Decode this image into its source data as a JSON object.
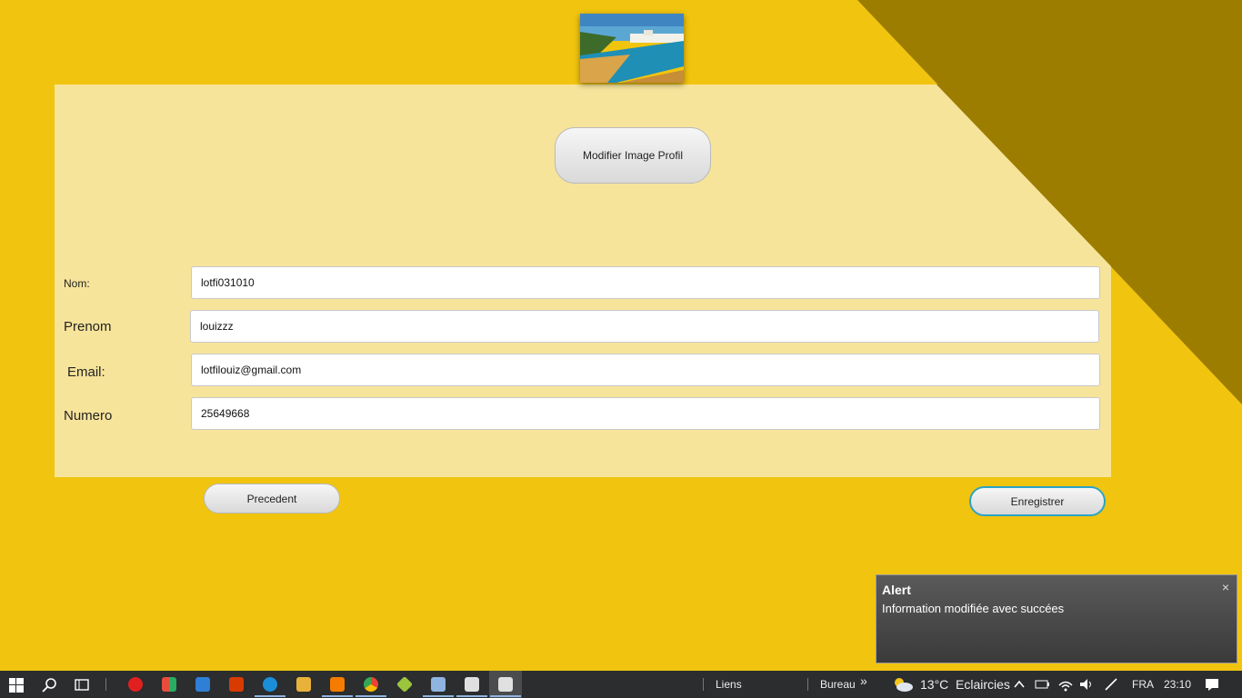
{
  "profile": {
    "modify_label": "Modifier Image Profil"
  },
  "form": {
    "nom_label": "Nom:",
    "nom_value": "lotfi031010",
    "prenom_label": "Prenom",
    "prenom_value": "louizzz",
    "email_label": "Email:",
    "email_value": "lotfilouiz@gmail.com",
    "numero_label": "Numero",
    "numero_value": "25649668"
  },
  "actions": {
    "prev_label": "Precedent",
    "save_label": "Enregistrer"
  },
  "alert": {
    "title": "Alert",
    "message": "Information modifiée avec succées",
    "close": "×"
  },
  "taskbar": {
    "liens": "Liens",
    "bureau": "Bureau",
    "chevron": "»",
    "temperature": "13°C",
    "weather": "Eclaircies",
    "language": "FRA",
    "time": "23:10"
  },
  "colors": {
    "background": "#f1c40f",
    "panel": "#f7e49b",
    "dark_triangle": "#9c7d00",
    "save_border": "#2aa3c7"
  }
}
